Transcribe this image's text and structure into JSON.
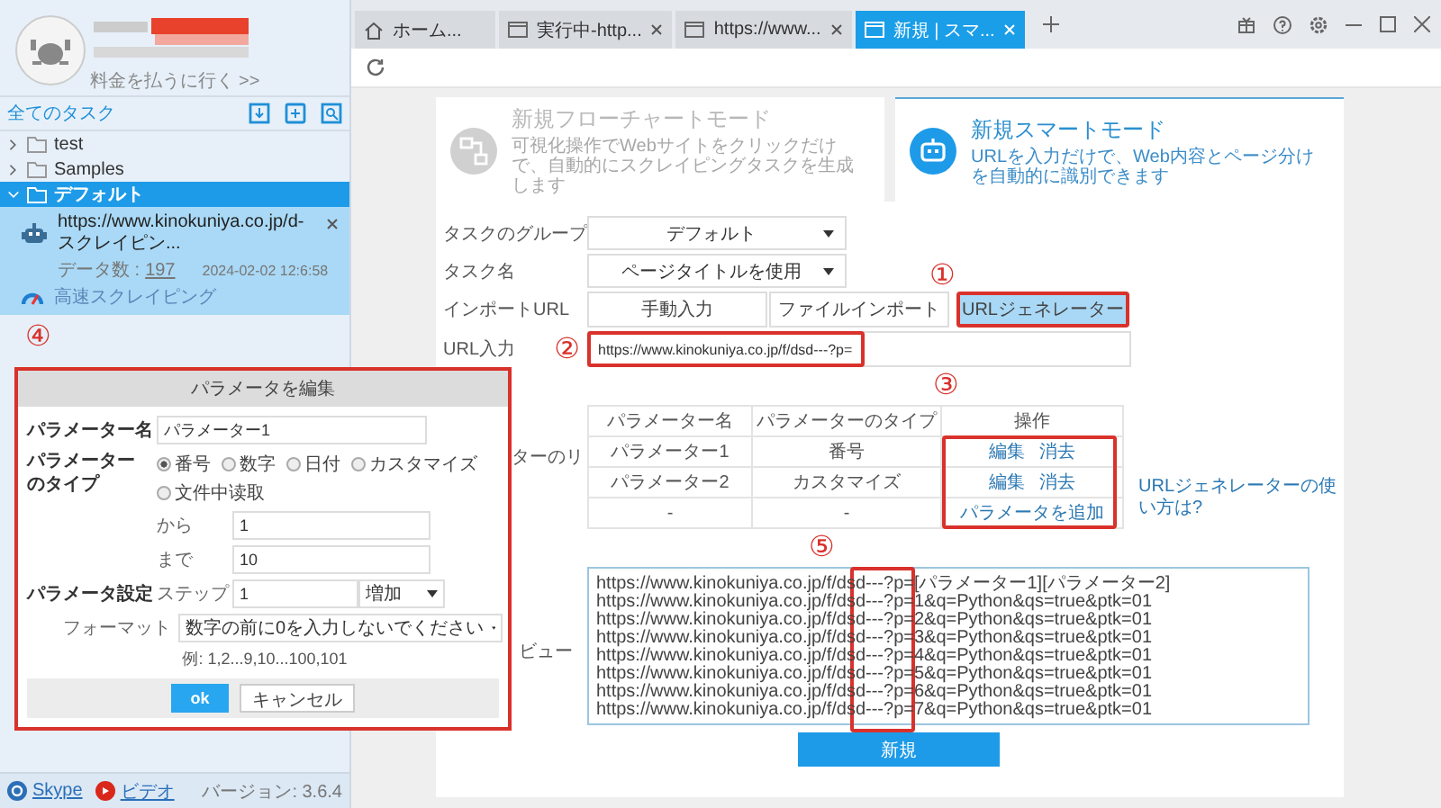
{
  "account": {
    "pay_link": "料金を払うに行く >>"
  },
  "sidebar": {
    "heading": "全てのタスク",
    "tree": [
      {
        "label": "test",
        "expanded": false,
        "selected": false
      },
      {
        "label": "Samples",
        "expanded": false,
        "selected": false
      },
      {
        "label": "デフォルト",
        "expanded": true,
        "selected": true,
        "children": [
          {
            "url": "https://www.kinokuniya.co.jp/d-スクレイピン...",
            "data_label": "データ数 :",
            "data_count": "197",
            "date": "2024-02-02 12:6:58",
            "mode": "高速スクレイピング"
          }
        ]
      }
    ]
  },
  "footer": {
    "links": [
      "Skype",
      "ビデオ"
    ],
    "version": "バージョン: 3.6.4"
  },
  "tabs": [
    {
      "label": "ホーム...",
      "kind": "home",
      "selected": false,
      "closable": false
    },
    {
      "label": "実行中-http...",
      "kind": "page",
      "selected": false,
      "closable": true
    },
    {
      "label": "https://www...",
      "kind": "page",
      "selected": false,
      "closable": true
    },
    {
      "label": "新規 | スマ...",
      "kind": "page",
      "selected": true,
      "closable": true
    }
  ],
  "modes": [
    {
      "title": "新規フローチャートモード",
      "description": "可視化操作でWebサイトをクリックだけで、自動的にスクレイピングタスクを生成します",
      "selected": false
    },
    {
      "title": "新規スマートモード",
      "description": "URLを入力だけで、Web内容とページ分けを自動的に識別できます",
      "selected": true
    }
  ],
  "form": {
    "group": {
      "label": "タスクのグループ",
      "value": "デフォルト"
    },
    "task_name": {
      "label": "タスク名",
      "value": "ページタイトルを使用"
    },
    "import": {
      "label": "インポートURL",
      "options": [
        {
          "label": "手動入力",
          "selected": false
        },
        {
          "label": "ファイルインポート",
          "selected": false
        },
        {
          "label": "URLジェネレーター",
          "selected": true
        }
      ]
    },
    "url": {
      "label": "URL入力",
      "value": "https://www.kinokuniya.co.jp/f/dsd---?p="
    },
    "params": {
      "label": "ターのリ",
      "columns": [
        "パラメーター名",
        "パラメーターのタイプ",
        "操作"
      ],
      "rows": [
        {
          "name": "パラメーター1",
          "type": "番号",
          "actions": [
            "編集",
            "消去"
          ]
        },
        {
          "name": "パラメーター2",
          "type": "カスタマイズ",
          "actions": [
            "編集",
            "消去"
          ]
        },
        {
          "name": "-",
          "type": "-",
          "actions": [
            "パラメータを追加"
          ]
        }
      ]
    },
    "help_link": "URLジェネレーターの使い方は?",
    "preview": {
      "label": "ビュー",
      "lines": [
        "https://www.kinokuniya.co.jp/f/dsd---?p=[パラメーター1][パラメーター2]",
        "https://www.kinokuniya.co.jp/f/dsd---?p=1&q=Python&qs=true&ptk=01",
        "https://www.kinokuniya.co.jp/f/dsd---?p=2&q=Python&qs=true&ptk=01",
        "https://www.kinokuniya.co.jp/f/dsd---?p=3&q=Python&qs=true&ptk=01",
        "https://www.kinokuniya.co.jp/f/dsd---?p=4&q=Python&qs=true&ptk=01",
        "https://www.kinokuniya.co.jp/f/dsd---?p=5&q=Python&qs=true&ptk=01",
        "https://www.kinokuniya.co.jp/f/dsd---?p=6&q=Python&qs=true&ptk=01",
        "https://www.kinokuniya.co.jp/f/dsd---?p=7&q=Python&qs=true&ptk=01"
      ]
    },
    "submit": "新規"
  },
  "dialog": {
    "title": "パラメータを編集",
    "name_label": "パラメーター名",
    "name_value": "パラメーター1",
    "type_label": "パラメーターのタイプ",
    "types": [
      {
        "label": "番号",
        "selected": true
      },
      {
        "label": "数字",
        "selected": false
      },
      {
        "label": "日付",
        "selected": false
      },
      {
        "label": "カスタマイズ",
        "selected": false
      },
      {
        "label": "文件中读取",
        "selected": false
      }
    ],
    "from_label": "から",
    "from_value": "1",
    "to_label": "まで",
    "to_value": "10",
    "settings_label": "パラメータ設定",
    "step_label": "ステップ",
    "step_value": "1",
    "step_mode": "増加",
    "format_label": "フォーマット",
    "format_value": "数字の前に0を入力しないでください",
    "example": "例: 1,2...9,10...100,101",
    "ok": "ok",
    "cancel": "キャンセル"
  },
  "annotations": [
    "①",
    "②",
    "③",
    "④",
    "⑤"
  ]
}
